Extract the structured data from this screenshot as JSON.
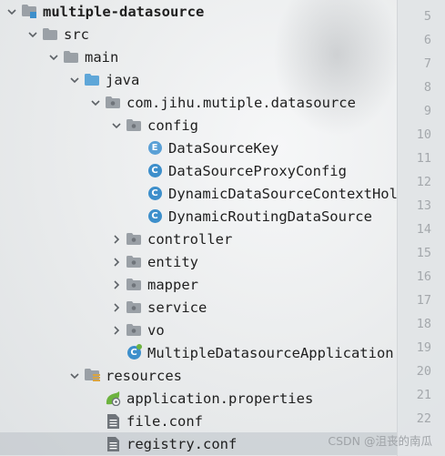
{
  "tree": [
    {
      "label": "multiple-datasource",
      "icon": "module-folder-icon",
      "chevron": "down",
      "bold": true,
      "indent": 0
    },
    {
      "label": "src",
      "icon": "folder-icon",
      "chevron": "down",
      "indent": 1
    },
    {
      "label": "main",
      "icon": "folder-icon",
      "chevron": "down",
      "indent": 2
    },
    {
      "label": "java",
      "icon": "source-folder-icon",
      "chevron": "down",
      "indent": 3
    },
    {
      "label": "com.jihu.mutiple.datasource",
      "icon": "package-icon",
      "chevron": "down",
      "indent": 4
    },
    {
      "label": "config",
      "icon": "package-icon",
      "chevron": "down",
      "indent": 5
    },
    {
      "label": "DataSourceKey",
      "icon": "enum-class-icon",
      "badge": "E",
      "chevron": "none",
      "indent": 6
    },
    {
      "label": "DataSourceProxyConfig",
      "icon": "class-icon",
      "badge": "C",
      "chevron": "none",
      "indent": 6
    },
    {
      "label": "DynamicDataSourceContextHolder",
      "icon": "class-icon",
      "badge": "C",
      "chevron": "none",
      "indent": 6
    },
    {
      "label": "DynamicRoutingDataSource",
      "icon": "class-icon",
      "badge": "C",
      "chevron": "none",
      "indent": 6
    },
    {
      "label": "controller",
      "icon": "package-icon",
      "chevron": "right",
      "indent": 5
    },
    {
      "label": "entity",
      "icon": "package-icon",
      "chevron": "right",
      "indent": 5
    },
    {
      "label": "mapper",
      "icon": "package-icon",
      "chevron": "right",
      "indent": 5
    },
    {
      "label": "service",
      "icon": "package-icon",
      "chevron": "right",
      "indent": 5
    },
    {
      "label": "vo",
      "icon": "package-icon",
      "chevron": "right",
      "indent": 5
    },
    {
      "label": "MultipleDatasourceApplication",
      "icon": "spring-boot-class-icon",
      "badge": "C",
      "chevron": "none",
      "indent": 5
    },
    {
      "label": "resources",
      "icon": "resources-folder-icon",
      "chevron": "down",
      "indent": 3
    },
    {
      "label": "application.properties",
      "icon": "spring-properties-icon",
      "chevron": "none",
      "indent": 4
    },
    {
      "label": "file.conf",
      "icon": "text-file-icon",
      "chevron": "none",
      "indent": 4
    },
    {
      "label": "registry.conf",
      "icon": "text-file-icon",
      "chevron": "none",
      "indent": 4,
      "selected": true
    }
  ],
  "line_numbers": [
    "5",
    "6",
    "7",
    "8",
    "9",
    "10",
    "11",
    "12",
    "13",
    "14",
    "15",
    "16",
    "17",
    "18",
    "19",
    "20",
    "21",
    "22"
  ],
  "watermark": "CSDN @沮丧的南瓜",
  "colors": {
    "folder": "#9aa0a6",
    "source_folder": "#5ea6d8",
    "class_badge": "#3d8fcb",
    "spring": "#6db33f"
  }
}
